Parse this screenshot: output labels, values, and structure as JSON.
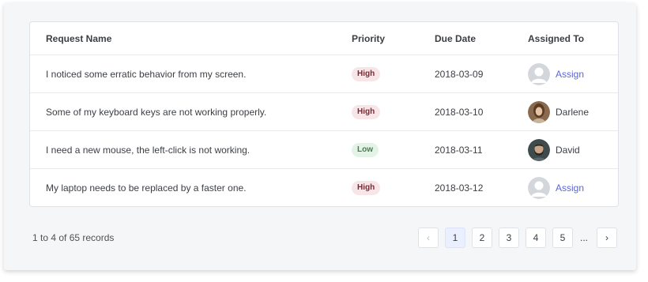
{
  "table": {
    "headers": {
      "name": "Request Name",
      "priority": "Priority",
      "due_date": "Due Date",
      "assigned_to": "Assigned To"
    },
    "rows": [
      {
        "name": "I noticed some erratic behavior from my screen.",
        "priority": "High",
        "due_date": "2018-03-09",
        "assigned": "Assign",
        "avatar_icon": "person-placeholder-icon"
      },
      {
        "name": "Some of my keyboard keys are not working properly.",
        "priority": "High",
        "due_date": "2018-03-10",
        "assigned": "Darlene",
        "avatar_icon": "user-photo-darlene"
      },
      {
        "name": "I need a new mouse, the left-click is not working.",
        "priority": "Low",
        "due_date": "2018-03-11",
        "assigned": "David",
        "avatar_icon": "user-photo-david"
      },
      {
        "name": "My laptop needs to be replaced by a faster one.",
        "priority": "High",
        "due_date": "2018-03-12",
        "assigned": "Assign",
        "avatar_icon": "person-placeholder-icon"
      }
    ]
  },
  "footer": {
    "records_text": "1 to 4 of 65 records"
  },
  "pagination": {
    "prev_icon": "‹",
    "pages": [
      "1",
      "2",
      "3",
      "4",
      "5"
    ],
    "current_page": "1",
    "ellipsis": "...",
    "next_icon": "›"
  },
  "colors": {
    "high_badge_bg": "#f8e5e7",
    "low_badge_bg": "#e3f4e6",
    "link": "#5a66d6",
    "active_page_bg": "#eaf0ff"
  }
}
